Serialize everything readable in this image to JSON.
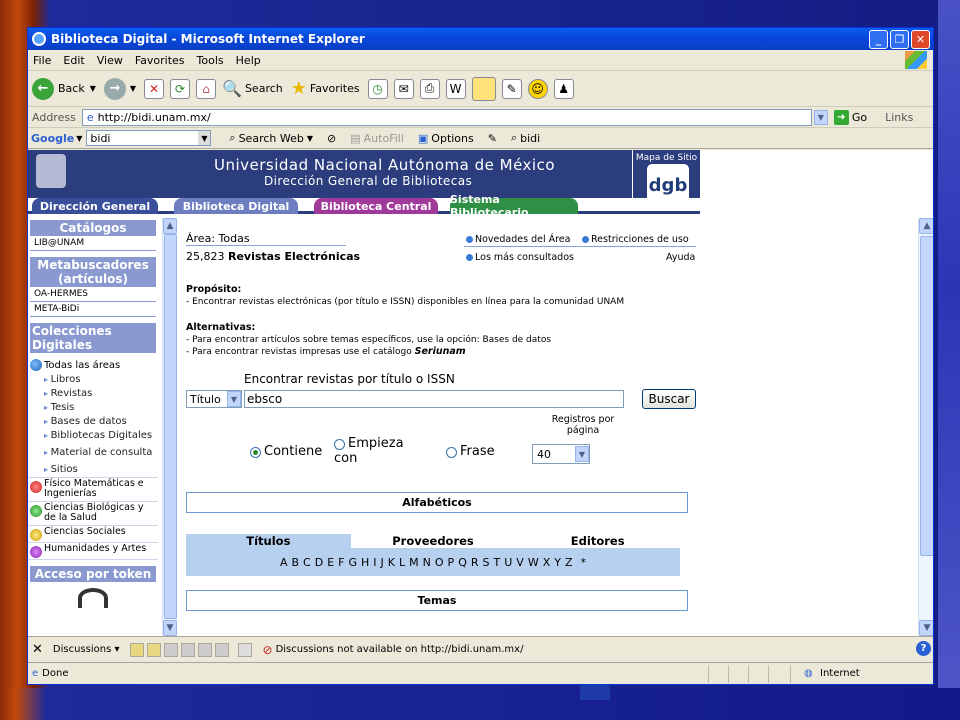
{
  "window": {
    "title": "Biblioteca Digital - Microsoft Internet Explorer",
    "buttons": [
      "_",
      "❐",
      "✕"
    ]
  },
  "menu": [
    "File",
    "Edit",
    "View",
    "Favorites",
    "Tools",
    "Help"
  ],
  "toolbar": {
    "back": "Back",
    "search": "Search",
    "favorites": "Favorites"
  },
  "address": {
    "label": "Address",
    "url": "http://bidi.unam.mx/",
    "go": "Go",
    "links": "Links"
  },
  "google": {
    "logo": "Google",
    "query": "bidi",
    "search_web": "Search Web",
    "autofill": "AutoFill",
    "options": "Options",
    "bidi": "bidi"
  },
  "site": {
    "header_line1": "Universidad Nacional Autónoma de México",
    "header_line2": "Dirección General de Bibliotecas",
    "map": "Mapa de Sitio",
    "logo_text": "dgb",
    "tabs": [
      {
        "label": "Dirección General",
        "color": "#3a4f9a"
      },
      {
        "label": "Biblioteca Digital",
        "color": "#6d7ec0"
      },
      {
        "label": "Biblioteca Central",
        "color": "#a03a9a"
      },
      {
        "label": "Sistema Bibliotecario",
        "color": "#2f8f45"
      }
    ]
  },
  "sidebar": {
    "catalogos": "Catálogos",
    "lib_unam": "LIB@UNAM",
    "metabuscadores": "Metabuscadores (artículos)",
    "oa_hermes": "OA-HERMES",
    "meta_bidi": "META-BiDi",
    "colecciones": "Colecciones Digitales",
    "todas": "Todas las áreas",
    "subitems": [
      "Libros",
      "Revistas",
      "Tesis",
      "Bases de datos",
      "Bibliotecas Digitales",
      "Material de consulta",
      "Sitios"
    ],
    "categories": [
      "Físico Matemáticas e Ingenierías",
      "Ciencias Biológicas y de la Salud",
      "Ciencias Sociales",
      "Humanidades y Artes"
    ],
    "acceso": "Acceso por token"
  },
  "main": {
    "area": "Área: Todas",
    "count_num": "25,823",
    "count_label": "Revistas Electrónicas",
    "link_novedades": "Novedades del Área",
    "link_restricciones": "Restricciones de uso",
    "link_mas": "Los más consultados",
    "link_ayuda": "Ayuda",
    "proposito_title": "Propósito:",
    "proposito_1": "- Encontrar revistas electrónicas (por título e ISSN) disponibles en línea para la comunidad UNAM",
    "alternativas_title": "Alternativas:",
    "alt_1": "- Para encontrar artículos sobre temas específicos, use la opción: Bases de datos",
    "alt_2": "- Para encontrar revistas impresas use el catálogo ",
    "alt_2_bold": "Seriunam",
    "search_title": "Encontrar revistas por título o ISSN",
    "select_field": "Título",
    "search_value": "ebsco",
    "buscar": "Buscar",
    "registros": "Registros por página",
    "radio_contiene": "Contiene",
    "radio_empieza": "Empieza con",
    "radio_frase": "Frase",
    "registros_value": "40",
    "alfabeticos": "Alfabéticos",
    "tabs": [
      "Títulos",
      "Proveedores",
      "Editores"
    ],
    "letters": [
      "A",
      "B",
      "C",
      "D",
      "E",
      "F",
      "G",
      "H",
      "I",
      "J",
      "K",
      "L",
      "M",
      "N",
      "O",
      "P",
      "Q",
      "R",
      "S",
      "T",
      "U",
      "V",
      "W",
      "X",
      "Y",
      "Z",
      "*"
    ],
    "temas": "Temas"
  },
  "iebar": {
    "discussions": "Discussions ▾",
    "message": "Discussions not available on http://bidi.unam.mx/"
  },
  "status": {
    "left": "Done",
    "zone": "Internet"
  }
}
